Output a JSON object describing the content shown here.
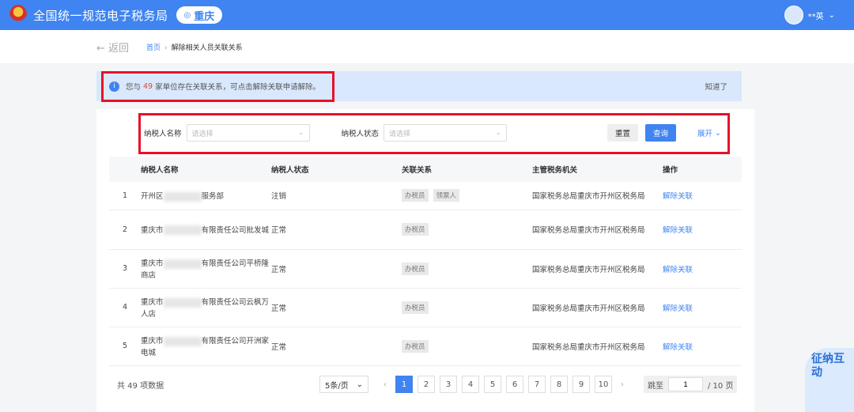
{
  "header": {
    "title": "全国统一规范电子税务局",
    "city": "重庆",
    "user": "**英"
  },
  "nav": {
    "back": "← 返回",
    "crumbs": [
      "首页",
      "解除相关人员关联关系"
    ]
  },
  "alert": {
    "before": "您与",
    "count": "49",
    "after": "家单位存在关联关系，可点击解除关联申请解除。",
    "dismiss": "知道了"
  },
  "filter": {
    "name_label": "纳税人名称",
    "name_placeholder": "请选择",
    "status_label": "纳税人状态",
    "status_placeholder": "请选择",
    "reset": "重置",
    "query": "查询",
    "expand": "展开"
  },
  "table": {
    "headers": [
      "纳税人名称",
      "纳税人状态",
      "关联关系",
      "主管税务机关",
      "操作"
    ],
    "rows": [
      {
        "idx": "1",
        "name_pre": "开州区",
        "name_post": "服务部",
        "status": "注销",
        "tags": [
          "办税员",
          "领票人"
        ],
        "office": "国家税务总局重庆市开州区税务局",
        "action": "解除关联"
      },
      {
        "idx": "2",
        "name_pre": "重庆市",
        "name_post": "有限责任公司批发城",
        "status": "正常",
        "tags": [
          "办税员"
        ],
        "office": "国家税务总局重庆市开州区税务局",
        "action": "解除关联"
      },
      {
        "idx": "3",
        "name_pre": "重庆市",
        "name_post": "有限责任公司平桥隆商店",
        "status": "正常",
        "tags": [
          "办税员"
        ],
        "office": "国家税务总局重庆市开州区税务局",
        "action": "解除关联"
      },
      {
        "idx": "4",
        "name_pre": "重庆市",
        "name_post": "有限责任公司云枫万人店",
        "status": "正常",
        "tags": [
          "办税员"
        ],
        "office": "国家税务总局重庆市开州区税务局",
        "action": "解除关联"
      },
      {
        "idx": "5",
        "name_pre": "重庆市",
        "name_post": "有限责任公司开洲家电城",
        "status": "正常",
        "tags": [
          "办税员"
        ],
        "office": "国家税务总局重庆市开州区税务局",
        "action": "解除关联"
      }
    ]
  },
  "pagination": {
    "total": "共 49 项数据",
    "page_size": "5条/页",
    "pages": [
      "1",
      "2",
      "3",
      "4",
      "5",
      "6",
      "7",
      "8",
      "9",
      "10"
    ],
    "current": "1",
    "jump_label": "跳至",
    "jump_value": "1",
    "page_count": "/ 10 页"
  },
  "mascot": {
    "text": "征纳互动"
  },
  "colors": {
    "primary": "#3f84f0",
    "highlight": "#e8102a",
    "count": "#e0463c"
  }
}
